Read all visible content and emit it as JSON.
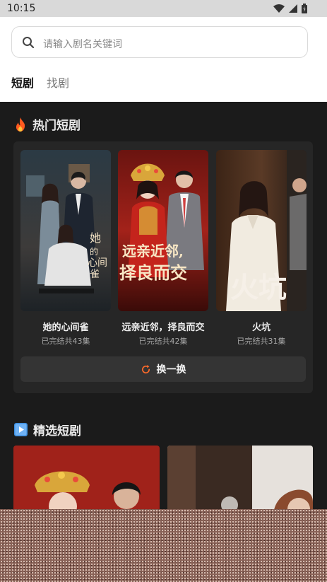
{
  "status_bar": {
    "time": "10:15"
  },
  "search": {
    "placeholder": "请输入剧名关键词"
  },
  "tabs": [
    {
      "label": "短剧",
      "active": true
    },
    {
      "label": "找剧",
      "active": false
    }
  ],
  "hot_section": {
    "title": "热门短剧",
    "icon": "fire-icon",
    "dramas": [
      {
        "title": "她的心间雀",
        "status": "已完结共43集",
        "poster_text": "她的心间雀"
      },
      {
        "title": "远亲近邻，择良而交",
        "status": "已完结共42集",
        "poster_text_line1": "远亲近邻,",
        "poster_text_line2": "择良而交"
      },
      {
        "title": "火坑",
        "status": "已完结共31集",
        "poster_text": "火坑"
      }
    ],
    "refresh_label": "换一换"
  },
  "featured_section": {
    "title": "精选短剧",
    "icon": "play-icon"
  },
  "colors": {
    "accent_fire": "#ff5a1f",
    "accent_refresh": "#ff6a2a",
    "panel": "#262626",
    "background": "#1b1b1b"
  }
}
